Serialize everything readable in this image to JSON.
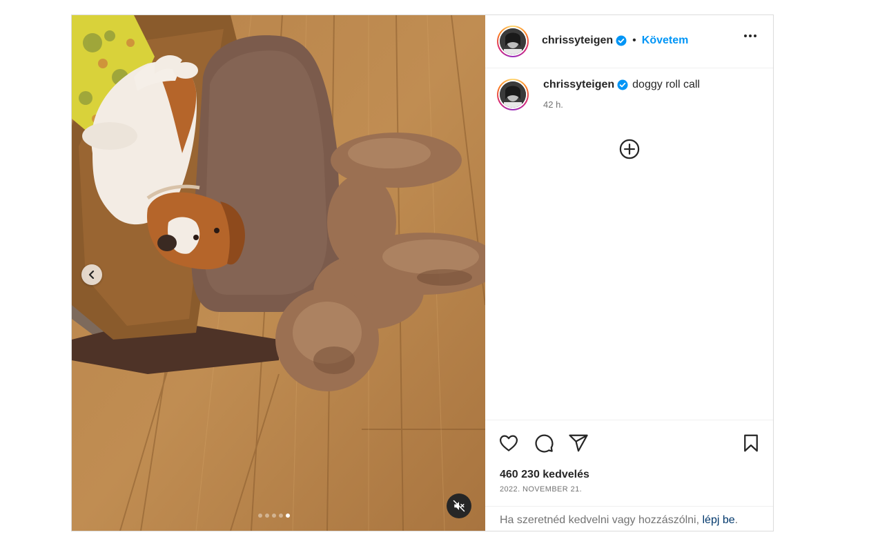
{
  "post": {
    "username": "chrissyteigen",
    "follow_label": "Követem",
    "separator": "•",
    "caption": "doggy roll call",
    "time_ago": "42 h.",
    "likes": "460 230 kedvelés",
    "date": "2022. NOVEMBER 21.",
    "login_prompt": "Ha szeretnéd kedvelni vagy hozzászólni,",
    "login_link": "lépj be",
    "login_suffix": "."
  },
  "carousel": {
    "total_slides": 5,
    "active_slide": 5,
    "muted": true
  },
  "colors": {
    "accent": "#0095f6",
    "verified": "#0095f6",
    "link": "#00376b",
    "muted_text": "#737373"
  },
  "icons": {
    "like": "heart-icon",
    "comment": "comment-icon",
    "share": "share-icon",
    "save": "bookmark-icon",
    "more": "more-options-icon",
    "load_comments": "plus-circle-icon",
    "prev": "chevron-left-icon",
    "mute": "speaker-muted-icon"
  }
}
